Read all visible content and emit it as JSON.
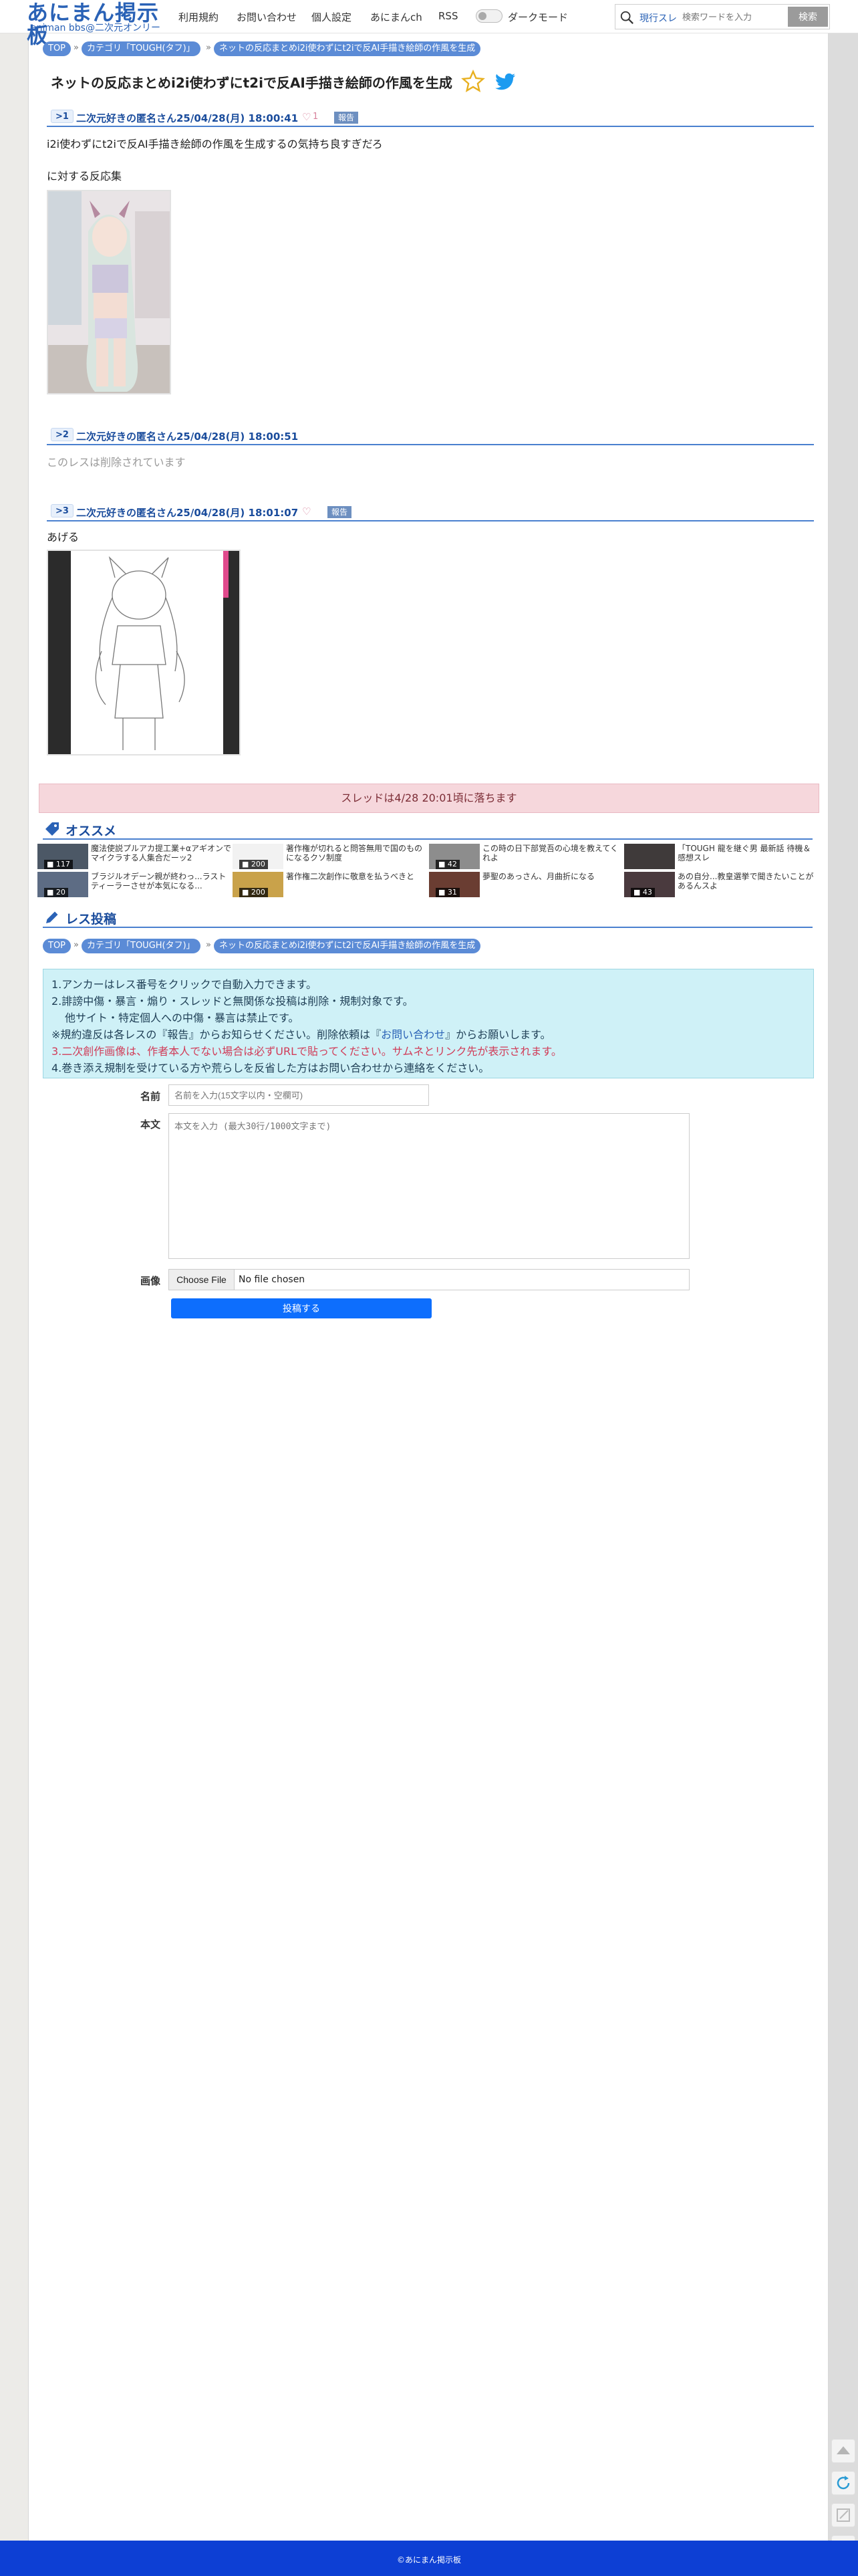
{
  "header": {
    "logo_main": "あにまん掲示板",
    "logo_sub": "animan bbs@二次元オンリー",
    "nav": [
      "利用規約",
      "お問い合わせ",
      "個人設定",
      "あにまんch",
      "RSS"
    ],
    "dark_mode_label": "ダークモード",
    "search_mode": "現行スレ",
    "search_placeholder": "検索ワードを入力",
    "search_button": "検索"
  },
  "breadcrumb_top": [
    "TOP",
    "カテゴリ「TOUGH(タフ)」",
    "ネットの反応まとめi2i使わずにt2iで反AI手描き絵師の作風を生成"
  ],
  "thread": {
    "title": "ネットの反応まとめi2i使わずにt2iで反AI手描き絵師の作風を生成"
  },
  "posts": [
    {
      "no": ">1",
      "name": "二次元好きの匿名さん",
      "date": "25/04/28(月) 18:00:41",
      "likes": "1",
      "report": "報告",
      "lines": [
        "i2i使わずにt2iで反AI手描き絵師の作風を生成するの気持ち良すぎだろ",
        "",
        "に対する反応集"
      ]
    },
    {
      "no": ">2",
      "name": "二次元好きの匿名さん",
      "date": "25/04/28(月) 18:00:51",
      "deleted_text": "このレスは削除されています"
    },
    {
      "no": ">3",
      "name": "二次元好きの匿名さん",
      "date": "25/04/28(月) 18:01:07",
      "report": "報告",
      "lines": [
        "あげる"
      ]
    }
  ],
  "expire_notice": "スレッドは4/28 20:01頃に落ちます",
  "recommend": {
    "title": "オススメ",
    "items": [
      {
        "count": "117",
        "text": "魔法使説プルアカ提工業+αアギオンでマイクラする人集合だーッ2"
      },
      {
        "count": "200",
        "text": "著作権が切れると問答無用で国のものになるクソ制度"
      },
      {
        "count": "42",
        "text": "この時の日下部覚吾の心境を教えてくれよ"
      },
      {
        "count": "",
        "text": "「TOUGH 龍を継ぐ男 最新話 待機＆感想スレ"
      },
      {
        "count": "20",
        "text": "ブラジルオデーン親が終わっ...ラストティーラーさせが本気になる..."
      },
      {
        "count": "200",
        "text": "著作権二次創作に敬意を払うべきと"
      },
      {
        "count": "31",
        "text": "夢聖のあっさん、月曲折になる"
      },
      {
        "count": "43",
        "text": "あの自分...教皇選挙で聞きたいことがあるんスよ"
      }
    ]
  },
  "post_form": {
    "title": "レス投稿",
    "breadcrumb": [
      "TOP",
      "カテゴリ「TOUGH(タフ)」",
      "ネットの反応まとめi2i使わずにt2iで反AI手描き絵師の作風を生成"
    ],
    "rules": {
      "r1": "1.アンカーはレス番号をクリックで自動入力できます。",
      "r2": "2.誹謗中傷・暴言・煽り・スレッドと無関係な投稿は削除・規制対象です。",
      "r2b": "他サイト・特定個人への中傷・暴言は禁止です。",
      "r3a": "※規約違反は各レスの『報告』からお知らせください。削除依頼は『",
      "r3link": "お問い合わせ",
      "r3b": "』からお願いします。",
      "r4a": "3.二次創作画像は、",
      "r4red": "作者本人でない場合は必ずURLで貼ってください。サムネとリンク先が表示されます。",
      "r5": "4.巻き添え規制を受けている方や荒らしを反省した方はお問い合わせから連絡をください。"
    },
    "name_label": "名前",
    "name_placeholder": "名前を入力(15文字以内・空欄可)",
    "body_label": "本文",
    "body_placeholder": "本文を入力 (最大30行/1000文字まで)",
    "image_label": "画像",
    "choose_file": "Choose File",
    "no_file": "No file chosen",
    "submit": "投稿する"
  },
  "footer": {
    "copyright": "©あにまん掲示板"
  },
  "colors": {
    "brand_blue": "#2a62b6",
    "accent_line": "#4a80cf",
    "footer_blue": "#0d3fd4",
    "submit_blue": "#0d6efd",
    "expire_bg": "#f6d7dc",
    "rules_bg": "#cff1f7"
  }
}
